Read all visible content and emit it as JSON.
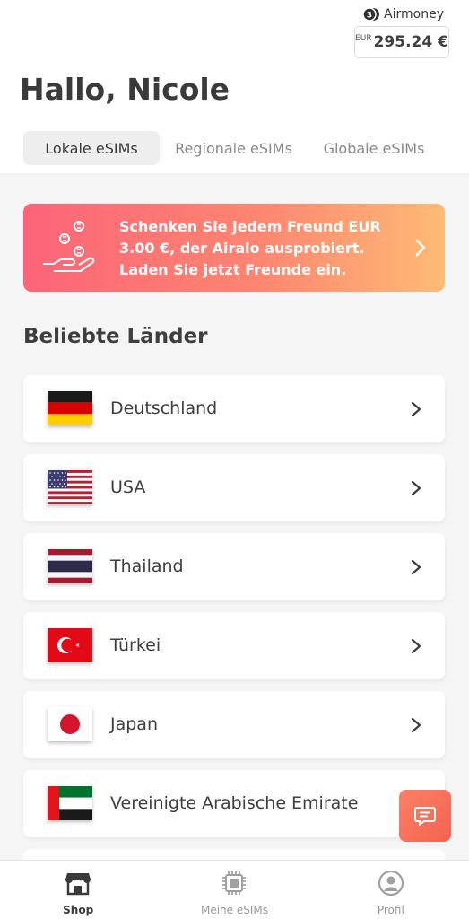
{
  "header": {
    "airmoney_label": "Airmoney",
    "balance_currency": "EUR",
    "balance_value": "295.24 €",
    "greeting": "Hallo, Nicole"
  },
  "tabs": [
    {
      "label": "Lokale eSIMs",
      "active": true
    },
    {
      "label": "Regionale eSIMs",
      "active": false
    },
    {
      "label": "Globale eSIMs",
      "active": false
    }
  ],
  "promo": {
    "text": "Schenken Sie jedem Freund EUR 3.00 €, der Airalo ausprobiert. Laden Sie jetzt Freunde ein.",
    "icon": "gift-coins-hand-icon"
  },
  "section_title": "Beliebte Länder",
  "countries": [
    {
      "name": "Deutschland",
      "flag": "germany-flag-icon"
    },
    {
      "name": "USA",
      "flag": "usa-flag-icon"
    },
    {
      "name": "Thailand",
      "flag": "thailand-flag-icon"
    },
    {
      "name": "Türkei",
      "flag": "turkey-flag-icon"
    },
    {
      "name": "Japan",
      "flag": "japan-flag-icon"
    },
    {
      "name": "Vereinigte Arabische Emirate",
      "flag": "uae-flag-icon"
    }
  ],
  "bottom_nav": [
    {
      "label": "Shop",
      "icon": "shop-icon",
      "active": true
    },
    {
      "label": "Meine eSIMs",
      "icon": "sim-chip-icon",
      "active": false
    },
    {
      "label": "Profil",
      "icon": "profile-icon",
      "active": false
    }
  ],
  "colors": {
    "promo_gradient_start": "#fc6478",
    "promo_gradient_end": "#fdbb75",
    "chat_button": "#f4634f",
    "background": "#f5f5f5"
  }
}
